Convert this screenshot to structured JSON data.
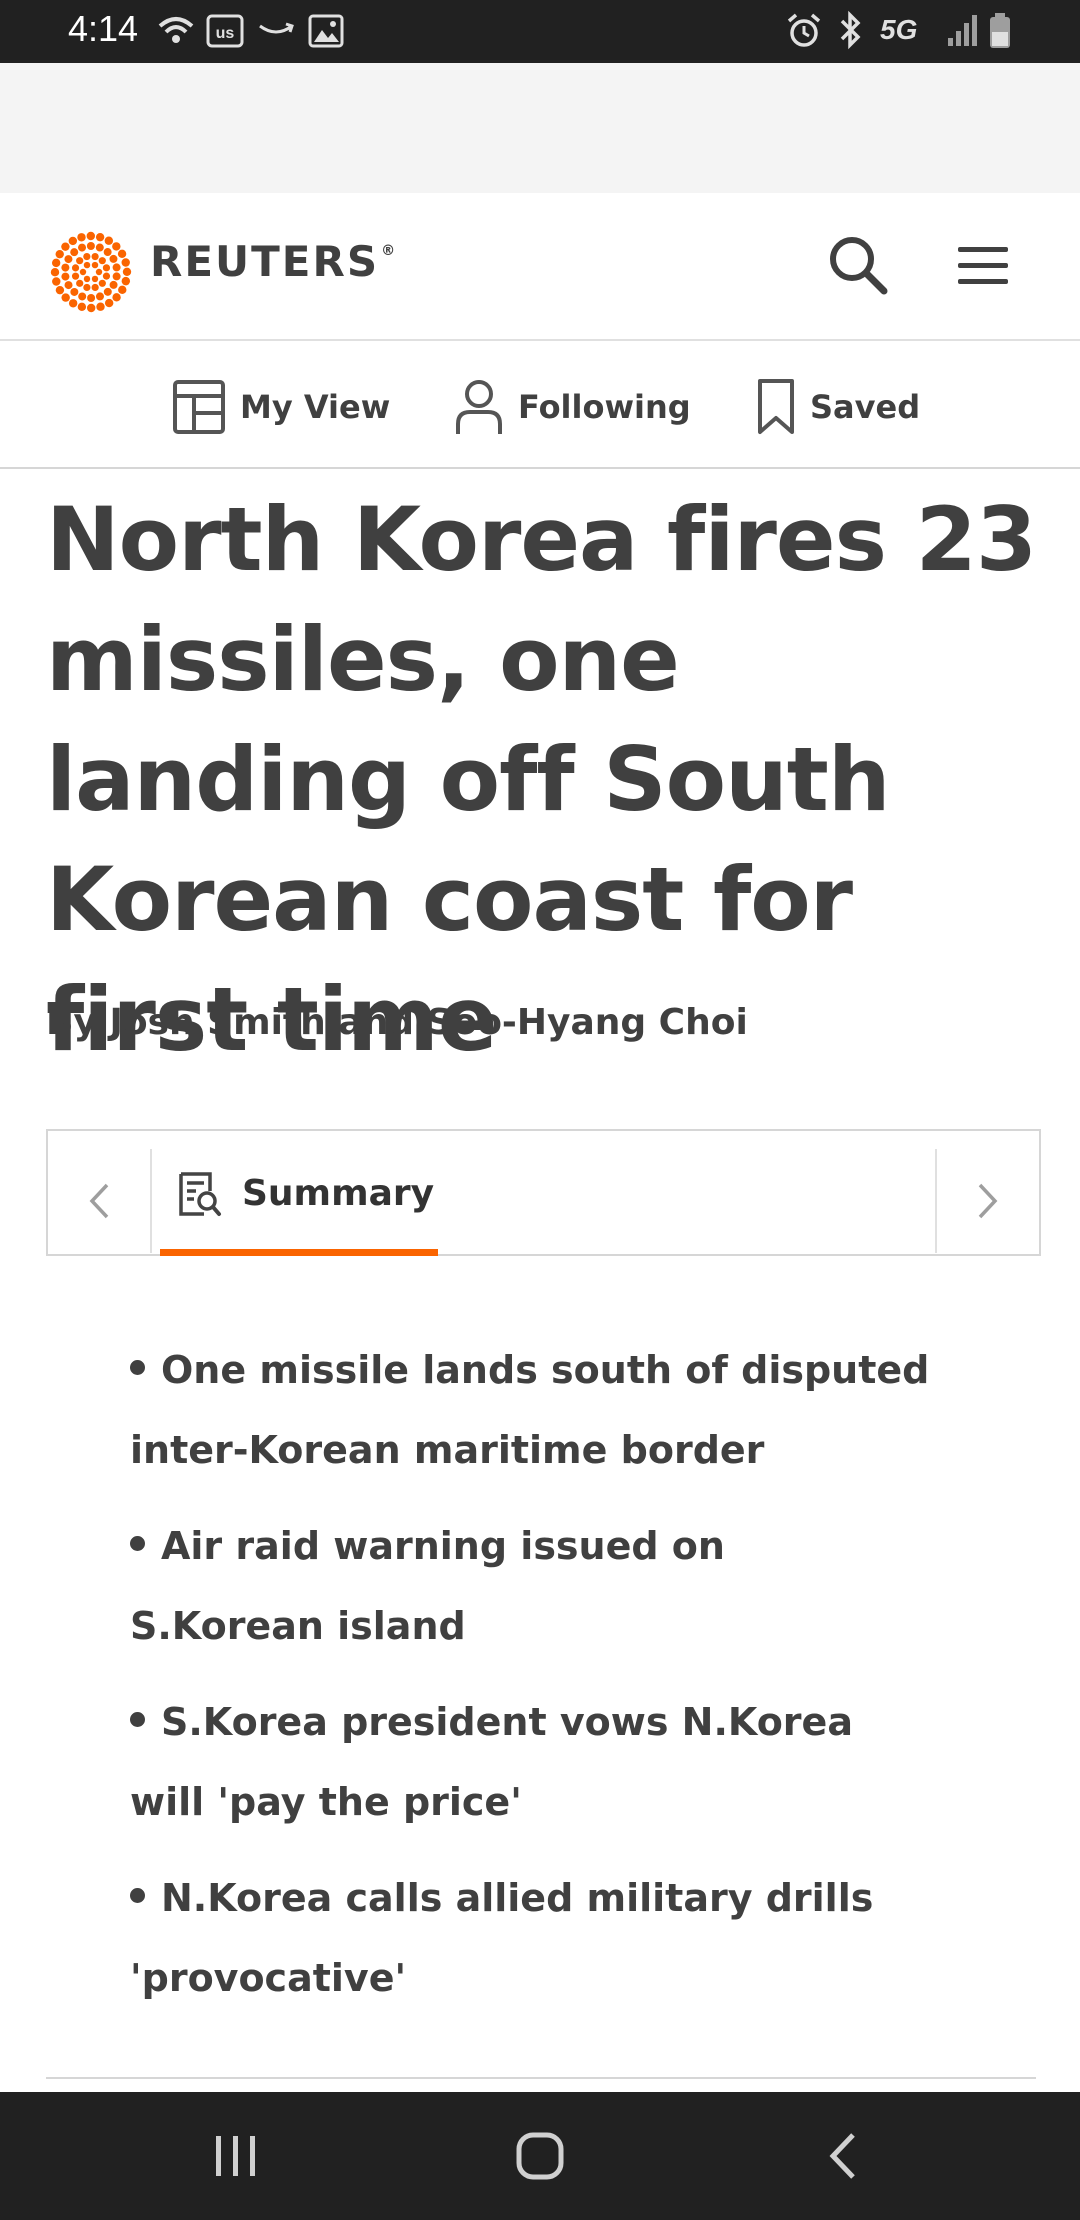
{
  "status_bar": {
    "time": "4:14",
    "network": "5G",
    "icons": [
      "wifi-icon",
      "us-app-icon",
      "amazon-icon",
      "image-icon",
      "alarm-icon",
      "bluetooth-icon",
      "signal-icon",
      "battery-icon"
    ]
  },
  "header": {
    "brand": "REUTERS",
    "registered": "®",
    "accent_color": "#fa6400"
  },
  "nav": {
    "items": [
      {
        "label": "My View",
        "icon": "layout-icon"
      },
      {
        "label": "Following",
        "icon": "person-icon"
      },
      {
        "label": "Saved",
        "icon": "bookmark-icon"
      }
    ]
  },
  "article": {
    "headline": "North Korea fires 23 missiles, one landing off South Korean coast for first time",
    "byline": "By Josh Smith and Soo-Hyang Choi"
  },
  "summary_tabs": {
    "active_label": "Summary",
    "active_icon": "summary-icon"
  },
  "summary": {
    "bullets": [
      "One missile lands south of disputed inter-Korean maritime border",
      "Air raid warning issued on S.Korean island",
      "S.Korea president vows N.Korea will 'pay the price'",
      "N.Korea calls allied military drills 'provocative'"
    ]
  },
  "system_nav": {
    "icons": [
      "recent-apps-icon",
      "home-icon",
      "back-icon"
    ]
  }
}
